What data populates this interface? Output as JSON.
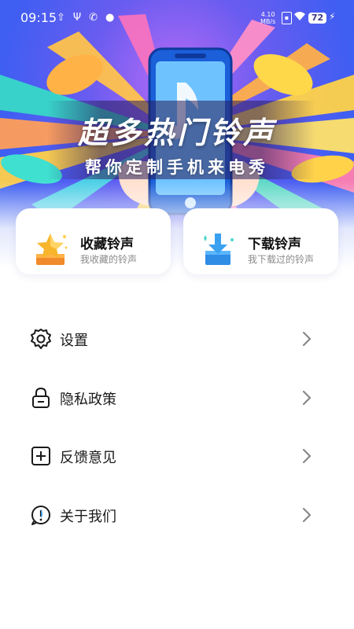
{
  "status_bar": {
    "time": "09:15",
    "net_speed_value": "4.10",
    "net_speed_unit": "MB/s",
    "battery": "72",
    "left_icons": [
      "upload-icon",
      "usb-icon",
      "phone-icon",
      "chat-icon"
    ]
  },
  "banner": {
    "title": "超多热门铃声",
    "subtitle": "帮你定制手机来电秀"
  },
  "cards": [
    {
      "title": "收藏铃声",
      "subtitle": "我收藏的铃声",
      "icon": "star-icon"
    },
    {
      "title": "下载铃声",
      "subtitle": "我下载过的铃声",
      "icon": "download-icon"
    }
  ],
  "menu": [
    {
      "label": "设置",
      "icon": "gear-icon"
    },
    {
      "label": "隐私政策",
      "icon": "lock-icon"
    },
    {
      "label": "反馈意见",
      "icon": "feedback-icon"
    },
    {
      "label": "关于我们",
      "icon": "info-icon"
    }
  ],
  "colors": {
    "banner_primary": "#4a5ff0",
    "star_gold": "#f7b52c",
    "download_blue": "#3aa0f0",
    "text_primary": "#1a1a1a",
    "text_secondary": "#8a8a8a"
  }
}
